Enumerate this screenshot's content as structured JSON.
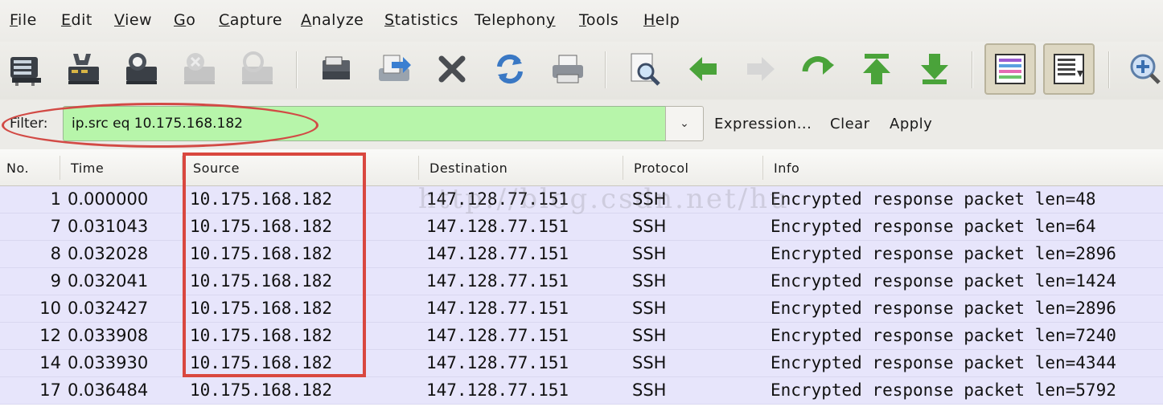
{
  "menu": [
    "File",
    "Edit",
    "View",
    "Go",
    "Capture",
    "Analyze",
    "Statistics",
    "Telephony",
    "Tools",
    "Help"
  ],
  "menu_mnemonic_index": [
    0,
    0,
    0,
    0,
    0,
    0,
    0,
    8,
    0,
    0
  ],
  "toolbar": {
    "icons": [
      "interfaces-icon",
      "capture-options-icon",
      "start-capture-icon",
      "stop-capture-icon",
      "restart-capture-icon",
      "open-file-icon",
      "save-file-icon",
      "close-file-icon",
      "reload-icon",
      "print-icon",
      "find-packet-icon",
      "go-back-icon",
      "go-forward-icon",
      "go-to-packet-icon",
      "go-first-icon",
      "go-last-icon",
      "colorize-icon",
      "autoscroll-icon",
      "zoom-in-icon"
    ]
  },
  "filter": {
    "label": "Filter:",
    "value": "ip.src eq 10.175.168.182",
    "expression_label": "Expression...",
    "clear_label": "Clear",
    "apply_label": "Apply",
    "valid_color": "#b7f5aa"
  },
  "columns": [
    "No.",
    "Time",
    "Source",
    "Destination",
    "Protocol",
    "Info"
  ],
  "packets": [
    {
      "no": "1",
      "time": "0.000000",
      "source": "10.175.168.182",
      "destination": "147.128.77.151",
      "protocol": "SSH",
      "info": "Encrypted response packet len=48"
    },
    {
      "no": "7",
      "time": "0.031043",
      "source": "10.175.168.182",
      "destination": "147.128.77.151",
      "protocol": "SSH",
      "info": "Encrypted response packet len=64"
    },
    {
      "no": "8",
      "time": "0.032028",
      "source": "10.175.168.182",
      "destination": "147.128.77.151",
      "protocol": "SSH",
      "info": "Encrypted response packet len=2896"
    },
    {
      "no": "9",
      "time": "0.032041",
      "source": "10.175.168.182",
      "destination": "147.128.77.151",
      "protocol": "SSH",
      "info": "Encrypted response packet len=1424"
    },
    {
      "no": "10",
      "time": "0.032427",
      "source": "10.175.168.182",
      "destination": "147.128.77.151",
      "protocol": "SSH",
      "info": "Encrypted response packet len=2896"
    },
    {
      "no": "12",
      "time": "0.033908",
      "source": "10.175.168.182",
      "destination": "147.128.77.151",
      "protocol": "SSH",
      "info": "Encrypted response packet len=7240"
    },
    {
      "no": "14",
      "time": "0.033930",
      "source": "10.175.168.182",
      "destination": "147.128.77.151",
      "protocol": "SSH",
      "info": "Encrypted response packet len=4344"
    },
    {
      "no": "17",
      "time": "0.036484",
      "source": "10.175.168.182",
      "destination": "147.128.77.151",
      "protocol": "SSH",
      "info": "Encrypted response packet len=5792"
    }
  ],
  "watermark": "http://blog.csdn.net/hu",
  "colors": {
    "row_bg": "#e7e5fb",
    "annotation_red": "#d9473f"
  }
}
